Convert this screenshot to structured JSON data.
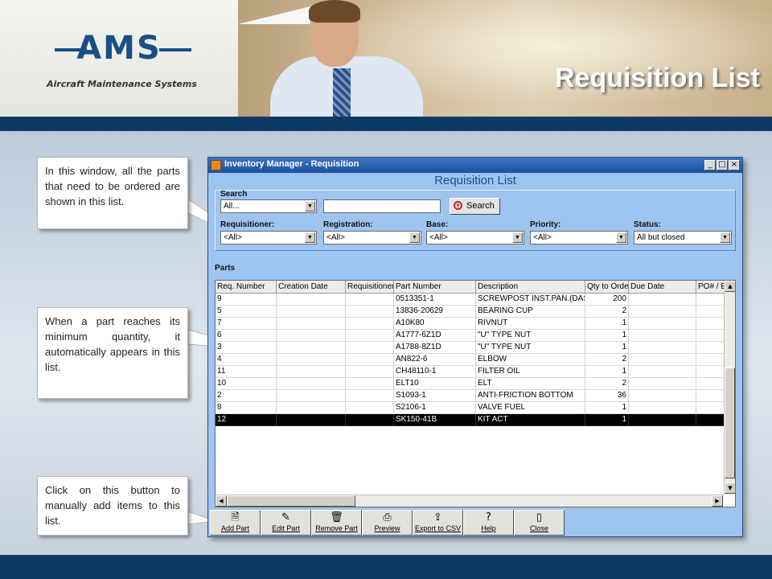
{
  "slide": {
    "title": "Requisition List",
    "logo": {
      "text": "AMS",
      "subtitle": "Aircraft Maintenance Systems"
    },
    "callouts": [
      "In this window, all the parts that need to be ordered are shown in this list.",
      "When a part reaches its minimum quantity, it automatically appears in this list.",
      "Click on this button to manually add items to this list."
    ]
  },
  "window": {
    "title": "Inventory Manager - Requisition",
    "controls": {
      "minimize": "_",
      "maximize": "□",
      "close": "×"
    },
    "heading": "Requisition List",
    "search": {
      "group_label": "Search",
      "field_value": "All...",
      "text_value": "",
      "button_label": "Search"
    },
    "filters": [
      {
        "label": "Requisitioner:",
        "value": "<All>"
      },
      {
        "label": "Registration:",
        "value": "<All>"
      },
      {
        "label": "Base:",
        "value": "<All>"
      },
      {
        "label": "Priority:",
        "value": "<All>"
      },
      {
        "label": "Status:",
        "value": "All but closed"
      }
    ],
    "parts_label": "Parts",
    "columns": [
      "Req. Number",
      "Creation Date",
      "Requisitioner",
      "Part Number",
      "Description",
      "Qty to Order",
      "Due Date",
      "PO# / E"
    ],
    "rows": [
      {
        "req": "9",
        "date": "",
        "requisitioner": "",
        "part": "0513351-1",
        "desc": "SCREWPOST INST.PAN.(DASH",
        "qty": "200",
        "due": "",
        "po": ""
      },
      {
        "req": "5",
        "date": "",
        "requisitioner": "",
        "part": "13836-20629",
        "desc": "BEARING CUP",
        "qty": "2",
        "due": "",
        "po": ""
      },
      {
        "req": "7",
        "date": "",
        "requisitioner": "",
        "part": "A10K80",
        "desc": "RIVNUT",
        "qty": "1",
        "due": "",
        "po": ""
      },
      {
        "req": "6",
        "date": "",
        "requisitioner": "",
        "part": "A1777-6Z1D",
        "desc": "\"U\" TYPE NUT",
        "qty": "1",
        "due": "",
        "po": ""
      },
      {
        "req": "3",
        "date": "",
        "requisitioner": "",
        "part": "A1788-8Z1D",
        "desc": "\"U\" TYPE NUT",
        "qty": "1",
        "due": "",
        "po": ""
      },
      {
        "req": "4",
        "date": "",
        "requisitioner": "",
        "part": "AN822-6",
        "desc": "ELBOW",
        "qty": "2",
        "due": "",
        "po": ""
      },
      {
        "req": "11",
        "date": "",
        "requisitioner": "",
        "part": "CH48110-1",
        "desc": "FILTER OIL",
        "qty": "1",
        "due": "",
        "po": ""
      },
      {
        "req": "10",
        "date": "",
        "requisitioner": "",
        "part": "ELT10",
        "desc": "ELT",
        "qty": "2",
        "due": "",
        "po": ""
      },
      {
        "req": "2",
        "date": "",
        "requisitioner": "",
        "part": "S1093-1",
        "desc": "ANTI-FRICTION BOTTOM",
        "qty": "36",
        "due": "",
        "po": ""
      },
      {
        "req": "8",
        "date": "",
        "requisitioner": "",
        "part": "S2106-1",
        "desc": "VALVE FUEL",
        "qty": "1",
        "due": "",
        "po": ""
      },
      {
        "req": "12",
        "date": "",
        "requisitioner": "",
        "part": "SK150-41B",
        "desc": "KIT ACT",
        "qty": "1",
        "due": "",
        "po": "",
        "selected": true
      }
    ],
    "toolbar": [
      {
        "label": "Add Part",
        "icon": "add-part-icon",
        "glyph": "🗎"
      },
      {
        "label": "Edit Part",
        "icon": "edit-part-icon",
        "glyph": "✎"
      },
      {
        "label": "Remove Part",
        "icon": "trash-icon",
        "glyph": "🗑"
      },
      {
        "label": "Preview",
        "icon": "printer-icon",
        "glyph": "⎙"
      },
      {
        "label": "Export to CSV",
        "icon": "export-icon",
        "glyph": "⇪"
      },
      {
        "label": "Help",
        "icon": "help-icon",
        "glyph": "?"
      },
      {
        "label": "Close",
        "icon": "door-icon",
        "glyph": "▯"
      }
    ]
  }
}
